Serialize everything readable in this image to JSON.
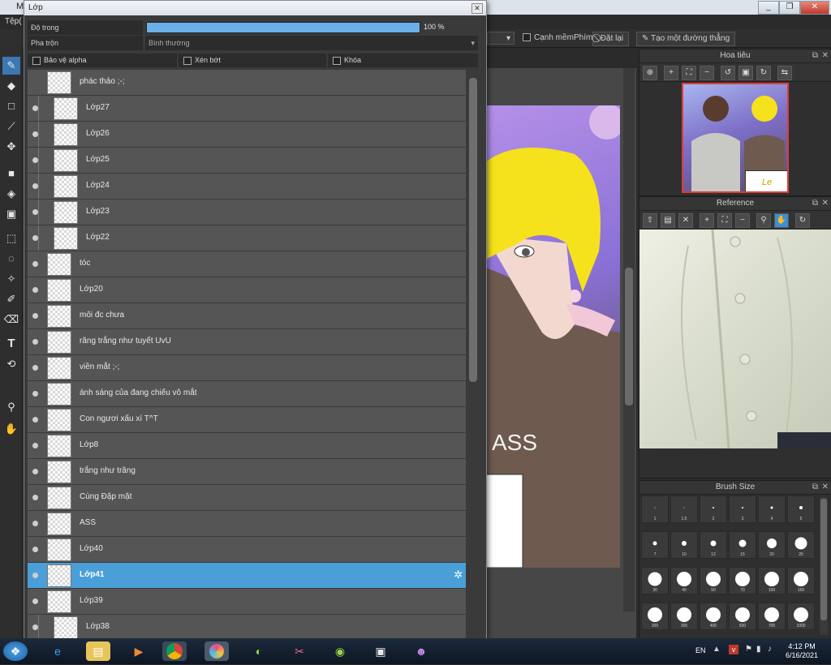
{
  "app": {
    "title": "M",
    "menu_file": "Tệp(",
    "window_controls": [
      "_",
      "❐",
      "✕"
    ]
  },
  "optbar": {
    "soft_edge_label": "Cạnh mềm",
    "key_label": "Phím",
    "reset_label": "Đặt lại",
    "straight_line_label": "Tạo một đường thẳng"
  },
  "toolbar": {
    "tools": [
      "brush-icon",
      "eraser-icon",
      "rect-icon",
      "line-icon",
      "move-icon",
      "fill-rect-icon",
      "bucket-icon",
      "gradient-icon",
      "select-rect-icon",
      "lasso-icon",
      "magic-wand-icon",
      "select-pen-icon",
      "select-eraser-icon",
      "text-icon",
      "divide-icon",
      "eyedropper-icon",
      "hand-icon"
    ],
    "active_index": 0
  },
  "layer_window": {
    "title": "Lớp",
    "close": "✕",
    "opacity_label": "Độ trong",
    "opacity_value": "100 %",
    "opacity_fraction": 1.0,
    "blend_label": "Pha trộn",
    "blend_value": "Bình thường",
    "protect_alpha": "Bảo vệ alpha",
    "clipping": "Xén bớt",
    "lock": "Khóa",
    "layers": [
      {
        "name": "phác thảo ;-;",
        "indent": 0,
        "eye": false,
        "folder": true
      },
      {
        "name": "Lớp27",
        "indent": 1,
        "eye": true
      },
      {
        "name": "Lớp26",
        "indent": 1,
        "eye": true
      },
      {
        "name": "Lớp25",
        "indent": 1,
        "eye": true
      },
      {
        "name": "Lớp24",
        "indent": 1,
        "eye": true
      },
      {
        "name": "Lớp23",
        "indent": 1,
        "eye": true
      },
      {
        "name": "Lớp22",
        "indent": 1,
        "eye": true
      },
      {
        "name": "tóc",
        "indent": 0,
        "eye": true
      },
      {
        "name": "Lớp20",
        "indent": 0,
        "eye": true
      },
      {
        "name": "môi đc chưa",
        "indent": 0,
        "eye": true
      },
      {
        "name": "răng trắng như tuyết UvU",
        "indent": 0,
        "eye": true
      },
      {
        "name": "viền mắt ;-;",
        "indent": 0,
        "eye": true
      },
      {
        "name": "ánh sáng của đang chiếu vô mắt",
        "indent": 0,
        "eye": true
      },
      {
        "name": "Con ngươi xấu xí T^T",
        "indent": 0,
        "eye": true
      },
      {
        "name": "Lớp8",
        "indent": 0,
        "eye": true
      },
      {
        "name": "trắng như trăng",
        "indent": 0,
        "eye": true
      },
      {
        "name": "Cùng Đập mặt",
        "indent": 0,
        "eye": true
      },
      {
        "name": "ASS",
        "indent": 0,
        "eye": true
      },
      {
        "name": "Lớp40",
        "indent": 0,
        "eye": true
      },
      {
        "name": "Lớp41",
        "indent": 0,
        "eye": true,
        "selected": true
      },
      {
        "name": "Lớp39",
        "indent": 0,
        "eye": true
      },
      {
        "name": "Lớp38",
        "indent": 1,
        "eye": true
      }
    ]
  },
  "canvas": {
    "art_text": "ASS"
  },
  "navigator": {
    "title": "Hoa tiêu",
    "signature": "Le"
  },
  "reference": {
    "title": "Reference"
  },
  "brush_size": {
    "title": "Brush Size",
    "sizes": [
      "1",
      "1.5",
      "2",
      "3",
      "4",
      "5",
      "7",
      "10",
      "12",
      "15",
      "20",
      "25",
      "30",
      "40",
      "50",
      "70",
      "100",
      "150",
      "200",
      "300",
      "400",
      "500",
      "700",
      "1000"
    ]
  },
  "taskbar": {
    "lang": "EN",
    "time": "4:12 PM",
    "date": "6/16/2021"
  }
}
